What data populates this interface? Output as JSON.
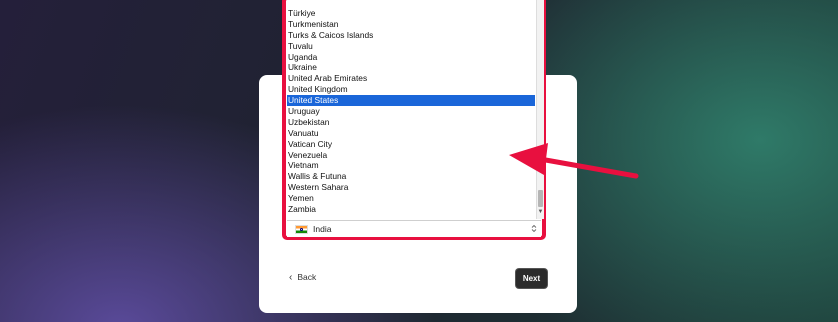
{
  "country_list": {
    "items": [
      "Türkiye",
      "Turkmenistan",
      "Turks & Caicos Islands",
      "Tuvalu",
      "Uganda",
      "Ukraine",
      "United Arab Emirates",
      "United Kingdom",
      "United States",
      "Uruguay",
      "Uzbekistan",
      "Vanuatu",
      "Vatican City",
      "Venezuela",
      "Vietnam",
      "Wallis & Futuna",
      "Western Sahara",
      "Yemen",
      "Zambia"
    ],
    "selected": "United States"
  },
  "country_select": {
    "value": "India",
    "flag_icon": "india-flag-icon"
  },
  "navigation": {
    "back_label": "Back",
    "next_label": "Next"
  },
  "colors": {
    "highlight": "#e8103f",
    "selected_row": "#1a66d9",
    "next_button": "#2b2b2b"
  }
}
